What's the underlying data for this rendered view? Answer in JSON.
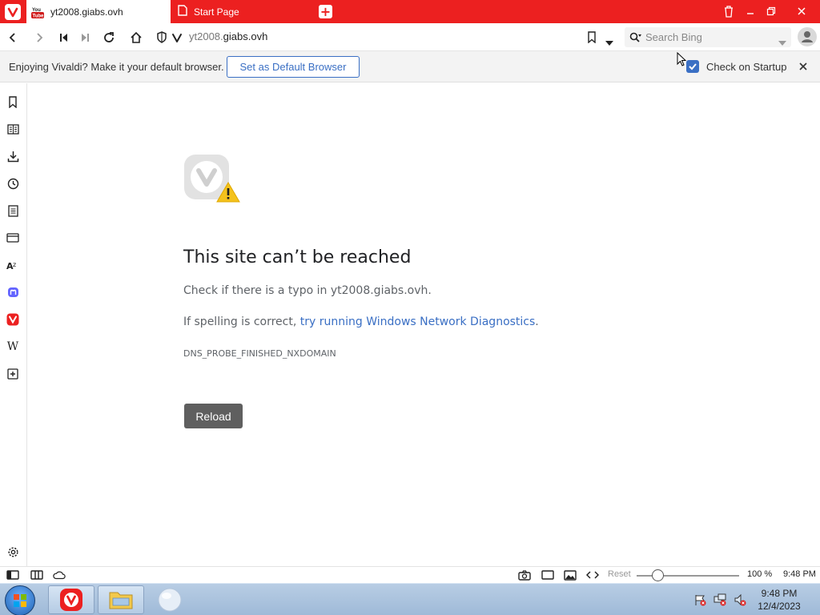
{
  "colors": {
    "brand": "#ec2020",
    "accent": "#3a6fc4",
    "reload_button": "#5f5f5f"
  },
  "tabs": [
    {
      "title": "yt2008.giabs.ovh",
      "icon": "youtube-icon",
      "active": true
    },
    {
      "title": "Start Page",
      "icon": "start-page-icon",
      "active": false
    }
  ],
  "address": {
    "url_prefix": "yt2008.",
    "url_domain": "giabs.ovh"
  },
  "search": {
    "placeholder": "Search Bing"
  },
  "notification": {
    "message": "Enjoying Vivaldi? Make it your default browser.",
    "button": "Set as Default Browser",
    "checkbox_label": "Check on Startup",
    "checked": true
  },
  "sidebar_icons": [
    "bookmarks-icon",
    "reading-list-icon",
    "downloads-icon",
    "history-icon",
    "notes-icon",
    "window-panel-icon",
    "translate-icon",
    "mastodon-icon",
    "vivaldi-icon",
    "wikipedia-icon",
    "add-panel-icon",
    "settings-icon"
  ],
  "error": {
    "title": "This site can’t be reached",
    "line1": "Check if there is a typo in yt2008.giabs.ovh.",
    "line2_prefix": "If spelling is correct, ",
    "line2_link": "try running Windows Network Diagnostics",
    "line2_suffix": ".",
    "code": "DNS_PROBE_FINISHED_NXDOMAIN",
    "reload": "Reload"
  },
  "statusbar": {
    "reset": "Reset",
    "zoom_level": "100 %",
    "time": "9:48 PM",
    "zoom_fraction": 0.17
  },
  "taskbar": {
    "time": "9:48 PM",
    "date": "12/4/2023"
  }
}
